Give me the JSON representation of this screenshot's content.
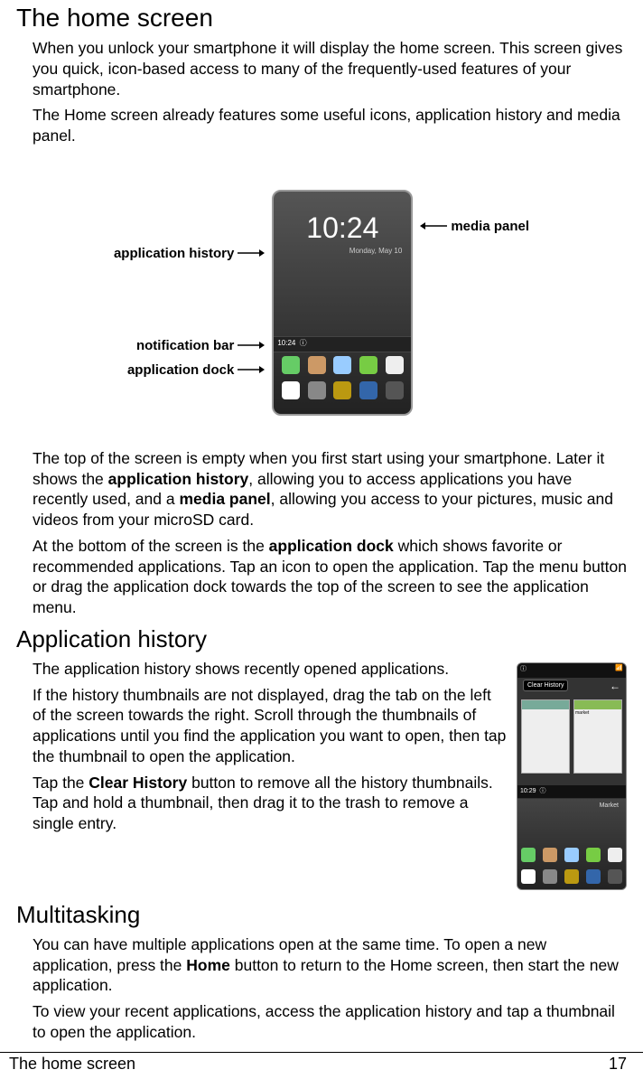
{
  "h1": "The home screen",
  "p1": "When you unlock your smartphone it will display the home screen. This screen gives you quick, icon-based access to many of the frequently-used features of your smartphone.",
  "p2": "The Home screen already features some useful icons, application history and media panel.",
  "labels": {
    "app_history": "application history",
    "notif_bar": "notification bar",
    "app_dock": "application dock",
    "media_panel": "media panel"
  },
  "phone": {
    "time": "10:24",
    "date": "Monday, May 10",
    "notif_time": "10:24"
  },
  "p3a": "The top of the screen is empty when you first start using your smartphone. Later it shows the ",
  "p3b": "application history",
  "p3c": ", allowing you to access applications you have recently used, and a ",
  "p3d": "media panel",
  "p3e": ", allowing you access to your pictures, music and videos from your microSD card.",
  "p4a": "At the bottom of the screen is the ",
  "p4b": "application dock",
  "p4c": " which shows favorite or recommended applications. Tap an icon to open the application. Tap the menu button or drag the application dock towards the top of the screen to see the application menu.",
  "h2a": "Application history",
  "p5": "The application history shows recently opened applications.",
  "p6": "If the history thumbnails are not displayed, drag the tab on the left of the screen towards the right. Scroll through the thumbnails of applications until you find the application you want to open, then tap the thumbnail to open the application.",
  "p7a": "Tap the ",
  "p7b": "Clear History",
  "p7c": " button to remove all the history thumbnails. Tap and hold a thumbnail, then drag it to the trash to remove a single entry.",
  "phone2": {
    "clear_history": "Clear History",
    "market": "market",
    "notif_time": "10:29",
    "mkt_label": "Market"
  },
  "h2b": "Multitasking",
  "p8a": "You can have multiple applications open at the same time. To open a new application, press the ",
  "p8b": "Home",
  "p8c": " button to return to the Home screen, then start the new application.",
  "p9": "To view your recent applications, access the application history and tap a thumbnail to open the application.",
  "footer_left": "The home screen",
  "footer_right": "17"
}
